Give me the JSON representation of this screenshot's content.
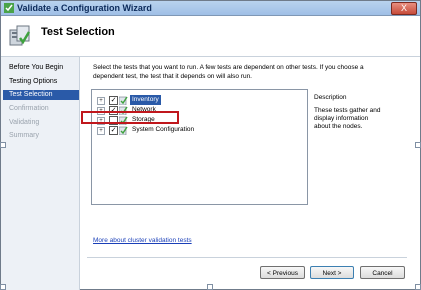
{
  "window": {
    "title": "Validate a Configuration Wizard",
    "close_label": "X"
  },
  "header": {
    "title": "Test Selection"
  },
  "sidebar": {
    "items": [
      {
        "label": "Before You Begin",
        "state": "normal"
      },
      {
        "label": "Testing Options",
        "state": "normal"
      },
      {
        "label": "Test Selection",
        "state": "active"
      },
      {
        "label": "Confirmation",
        "state": "disabled"
      },
      {
        "label": "Validating",
        "state": "disabled"
      },
      {
        "label": "Summary",
        "state": "disabled"
      }
    ]
  },
  "main": {
    "instructions": "Select the tests that you want to run.  A few tests are dependent on other tests.  If you choose a dependent test, the test that it depends on will also run.",
    "tree": [
      {
        "label": "Inventory",
        "checked": true,
        "selected": true
      },
      {
        "label": "Network",
        "checked": true,
        "selected": false
      },
      {
        "label": "Storage",
        "checked": false,
        "selected": false
      },
      {
        "label": "System Configuration",
        "checked": true,
        "selected": false
      }
    ],
    "description_title": "Description",
    "description_text": "These tests gather and display information about the nodes.",
    "more_link": "More about cluster validation tests"
  },
  "buttons": {
    "previous": "< Previous",
    "next": "Next >",
    "cancel": "Cancel"
  },
  "colors": {
    "accent": "#2a5aa8",
    "highlight_box": "#c0171c",
    "link": "#1a3fb8"
  }
}
